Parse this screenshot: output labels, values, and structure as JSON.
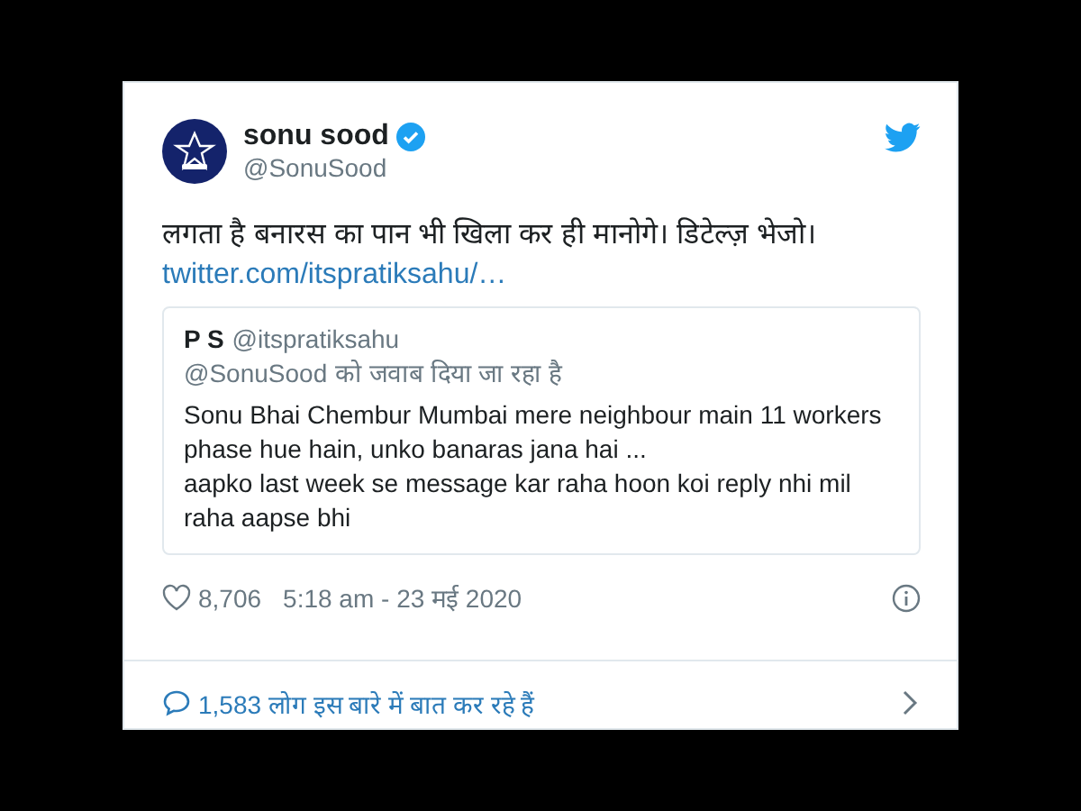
{
  "author": {
    "name": "sonu sood",
    "verified": true,
    "handle": "@SonuSood"
  },
  "text": "लगता है बनारस का पान भी खिला कर ही मानोगे। डिटेल्ज़ भेजो।",
  "link": "twitter.com/itspratiksahu/…",
  "quoted": {
    "name": "P S",
    "handle": "@itspratiksahu",
    "reply_to": "@SonuSood",
    "reply_suffix": "को जवाब दिया जा रहा है",
    "paragraphs": [
      "Sonu Bhai Chembur Mumbai mere neighbour main 11 workers phase hue hain, unko banaras jana hai ...",
      "aapko last week se message kar raha hoon koi reply nhi mil raha aapse bhi"
    ]
  },
  "likes": "8,706",
  "timestamp": "5:18 am - 23 मई 2020",
  "conversation": "1,583 लोग इस बारे में बात कर रहे हैं"
}
